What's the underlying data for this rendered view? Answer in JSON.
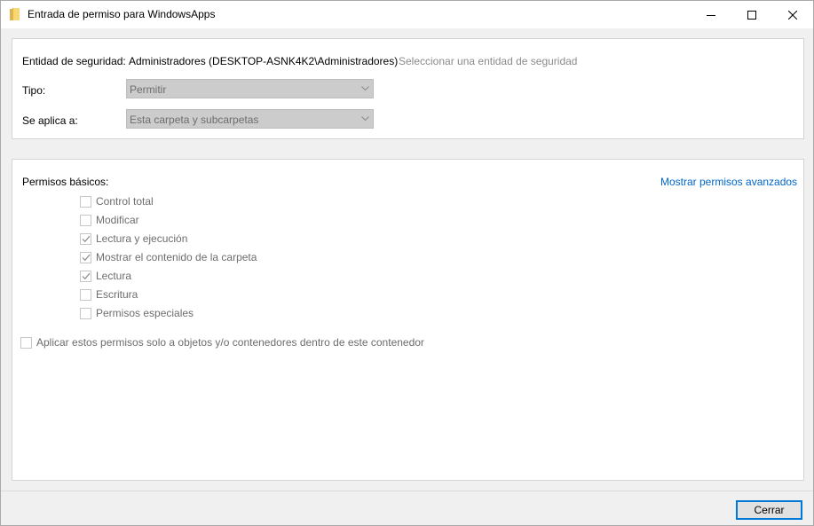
{
  "window": {
    "title": "Entrada de permiso para WindowsApps"
  },
  "principal": {
    "label": "Entidad de seguridad:",
    "value": "Administradores (DESKTOP-ASNK4K2\\Administradores)",
    "select_link": "Seleccionar una entidad de seguridad"
  },
  "type": {
    "label": "Tipo:",
    "value": "Permitir"
  },
  "applies_to": {
    "label": "Se aplica a:",
    "value": "Esta carpeta y subcarpetas"
  },
  "permissions": {
    "heading": "Permisos básicos:",
    "advanced_link": "Mostrar permisos avanzados",
    "items": [
      {
        "label": "Control total",
        "checked": false
      },
      {
        "label": "Modificar",
        "checked": false
      },
      {
        "label": "Lectura y ejecución",
        "checked": true
      },
      {
        "label": "Mostrar el contenido de la carpeta",
        "checked": true
      },
      {
        "label": "Lectura",
        "checked": true
      },
      {
        "label": "Escritura",
        "checked": false
      },
      {
        "label": "Permisos especiales",
        "checked": false
      }
    ],
    "apply_only_label": "Aplicar estos permisos solo a objetos y/o contenedores dentro de este contenedor",
    "apply_only_checked": false
  },
  "footer": {
    "close_label": "Cerrar"
  },
  "colors": {
    "link_blue": "#0066cc",
    "disabled_text": "#6d6d6d",
    "folder_yellow": "#f8d775"
  }
}
